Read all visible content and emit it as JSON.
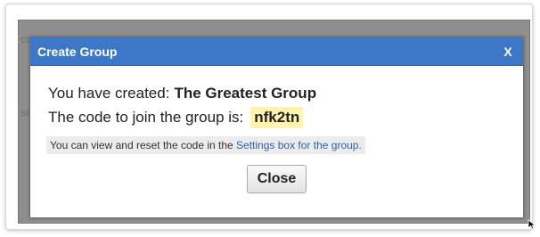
{
  "background": {
    "fragments": [
      "co",
      "se"
    ]
  },
  "dialog": {
    "title": "Create Group",
    "close_glyph": "X",
    "created_prefix": "You have created:",
    "group_name": "The Greatest Group",
    "code_prefix": "The code to join the group is:",
    "code": "nfk2tn",
    "note_text": "You can view and reset the code in the",
    "note_link": "Settings box for the group.",
    "close_button_label": "Close"
  },
  "colors": {
    "header": "#3d78c8",
    "code_highlight": "#fff3b0",
    "link": "#2a63b5"
  },
  "icons": {
    "close": "close-icon",
    "cursor": "mouse-cursor-icon"
  }
}
